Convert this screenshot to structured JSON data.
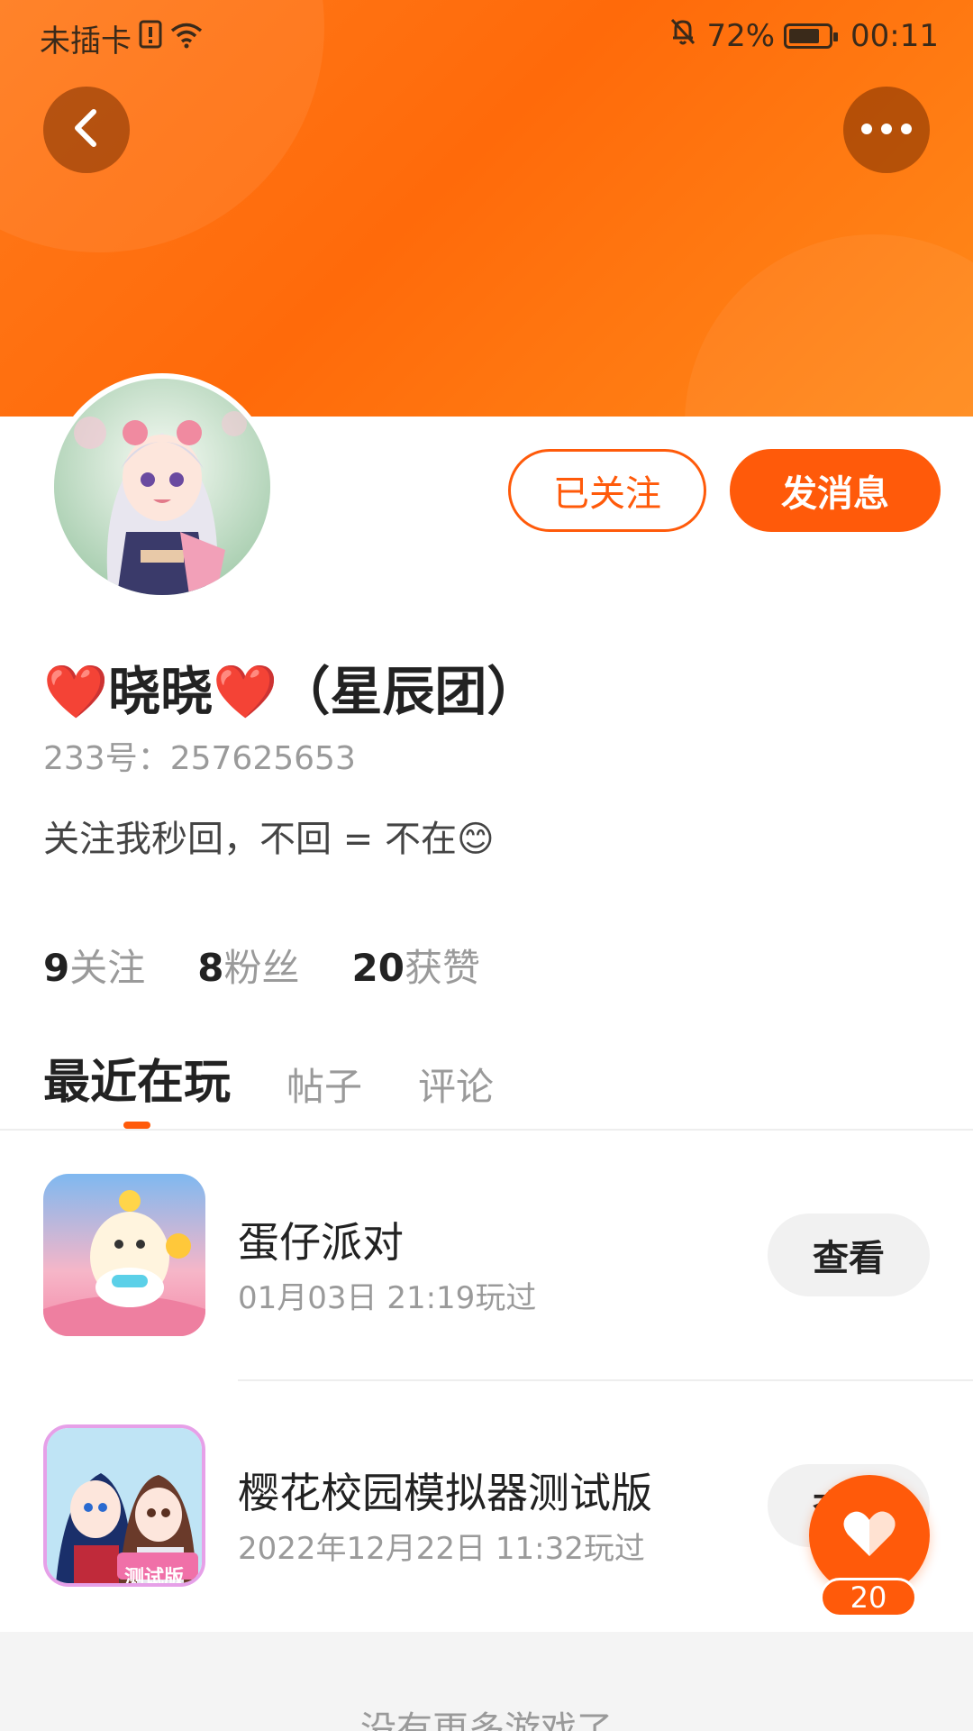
{
  "status_bar": {
    "carrier": "未插卡",
    "battery_percent": "72%",
    "time": "00:11"
  },
  "header": {
    "back_icon": "chevron-left-icon",
    "more_icon": "more-horizontal-icon"
  },
  "profile": {
    "follow_button": "已关注",
    "message_button": "发消息",
    "nickname": "❤️晓晓❤️（星辰团）",
    "user_id": "233号：257625653",
    "bio": "关注我秒回，不回 = 不在😊",
    "stats": [
      {
        "num": "9",
        "label": "关注"
      },
      {
        "num": "8",
        "label": "粉丝"
      },
      {
        "num": "20",
        "label": "获赞"
      }
    ]
  },
  "tabs": [
    {
      "label": "最近在玩",
      "active": true
    },
    {
      "label": "帖子",
      "active": false
    },
    {
      "label": "评论",
      "active": false
    }
  ],
  "games": [
    {
      "name": "蛋仔派对",
      "last_played": "01月03日 21:19玩过",
      "button": "查看"
    },
    {
      "name": "樱花校园模拟器测试版",
      "last_played": "2022年12月22日 11:32玩过",
      "button": "查看",
      "icon_badge": "测试版"
    }
  ],
  "footer": {
    "text": "没有更多游戏了"
  },
  "like_fab": {
    "count": "20"
  },
  "colors": {
    "accent": "#ff5a0a",
    "header_orange": "#ff7a1a"
  }
}
